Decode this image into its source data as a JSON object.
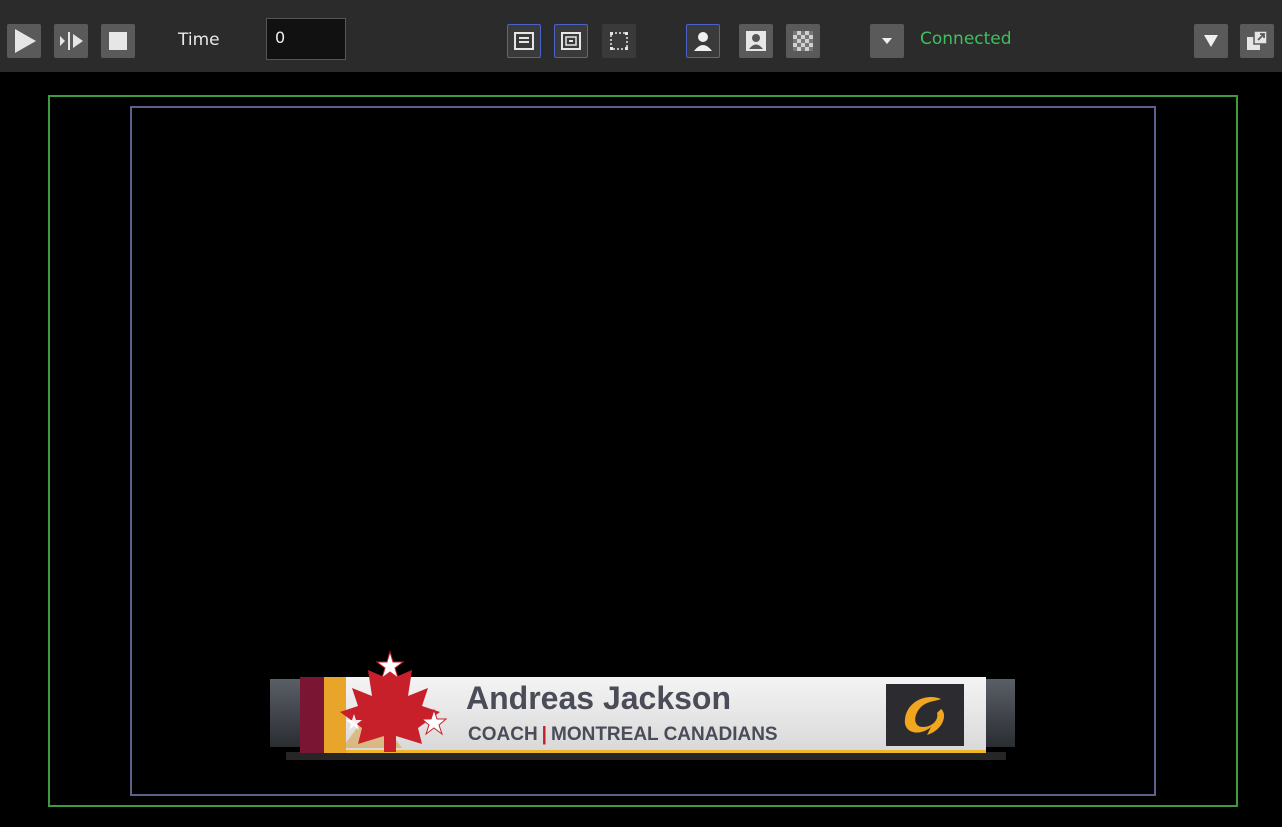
{
  "toolbar": {
    "play_icon": "play-icon",
    "step_icon": "step-frame-icon",
    "stop_icon": "stop-icon",
    "time_label": "Time",
    "time_value": "0",
    "view_buttons": [
      "safe-area-icon",
      "title-area-icon",
      "bounding-box-icon"
    ],
    "key_buttons": [
      "key-person-icon",
      "fill-person-icon",
      "alpha-checker-icon"
    ],
    "connection_dropdown_icon": "chevron-down-icon",
    "status": "Connected",
    "status_color": "#3fbf5f",
    "menu_icon": "triangle-down-icon",
    "detach_icon": "external-window-icon"
  },
  "lower_third": {
    "name": "Andreas Jackson",
    "role": "COACH",
    "separator": "|",
    "team": "MONTREAL CANADIANS",
    "accent_maroon": "#7a1533",
    "accent_gold": "#e9a52a",
    "leaf_color": "#c8202a",
    "logo_icon": "swoosh-logo-icon"
  },
  "overlays": {
    "safe_action_color": "#3f9a3f",
    "safe_title_color": "#5f5f8c"
  }
}
